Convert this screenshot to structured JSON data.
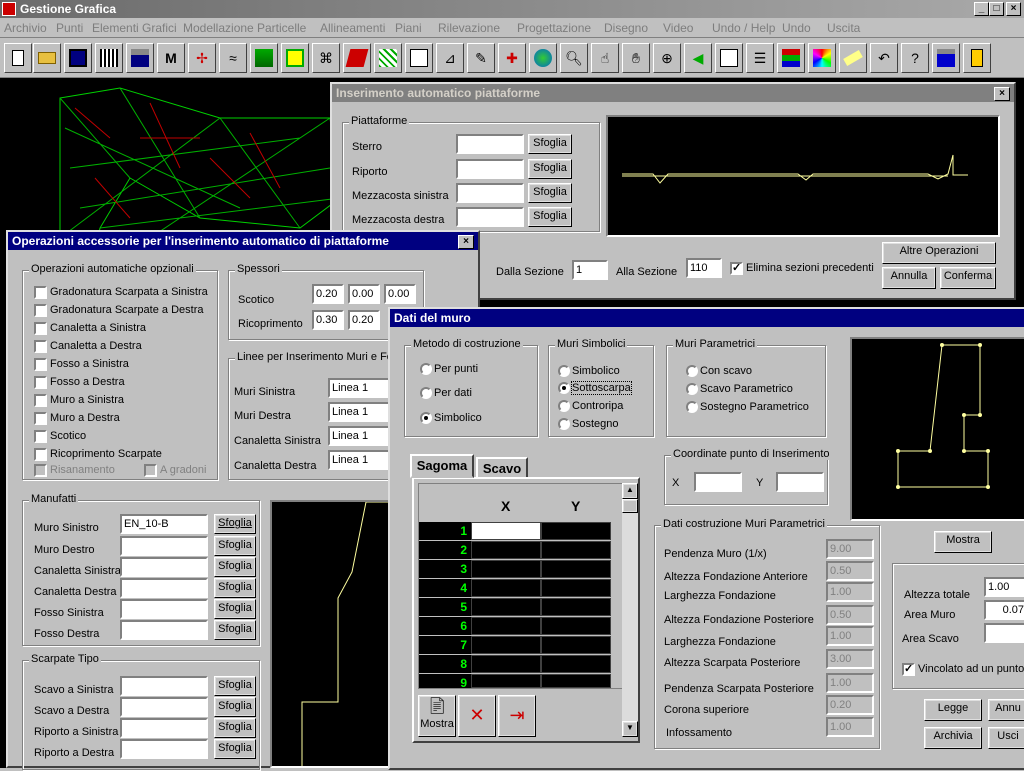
{
  "app": {
    "title": "Gestione Grafica",
    "min": "_",
    "max": "□",
    "close": "×"
  },
  "menu": [
    "Archivio",
    "Punti",
    "Elementi Grafici",
    "Modellazione",
    "Particelle",
    "Allineamenti",
    "Piani",
    "Rilevazione",
    "Progettazione",
    "Disegno",
    "Video",
    "Undo / Help",
    "Undo",
    "Uscita"
  ],
  "toolbar_m_label": "M",
  "piattaforme": {
    "title": "Inserimento automatico piattaforme",
    "group": "Piattaforme",
    "rows": [
      "Sterro",
      "Riporto",
      "Mezzacosta sinistra",
      "Mezzacosta destra"
    ],
    "browse": "Sfoglia",
    "dalla_label": "Dalla Sezione",
    "dalla_val": "1",
    "alla_label": "Alla Sezione",
    "alla_val": "110",
    "elimina": "Elimina sezioni precedenti",
    "altre": "Altre Operazioni",
    "annulla": "Annulla",
    "conferma": "Conferma"
  },
  "accessorie": {
    "title": "Operazioni accessorie per l'inserimento automatico di piattaforme",
    "auto_group": "Operazioni automatiche opzionali",
    "auto_items": [
      "Gradonatura Scarpata a Sinistra",
      "Gradonatura Scarpate a Destra",
      "Canaletta a Sinistra",
      "Canaletta a Destra",
      "Fosso a Sinistra",
      "Fosso a Destra",
      "Muro a Sinistra",
      "Muro a Destra",
      "Scotico",
      "Ricoprimento Scarpate"
    ],
    "risanamento": "Risanamento",
    "a_gradoni": "A gradoni",
    "spessori_group": "Spessori",
    "scotico_label": "Scotico",
    "scotico_vals": [
      "0.20",
      "0.00",
      "0.00"
    ],
    "ricopr_label": "Ricoprimento",
    "ricopr_vals": [
      "0.30",
      "0.20"
    ],
    "linee_group": "Linee per Inserimento Muri e Fos",
    "linee_rows": [
      {
        "label": "Muri Sinistra",
        "val": "Linea 1"
      },
      {
        "label": "Muri Destra",
        "val": "Linea 1"
      },
      {
        "label": "Canaletta Sinistra",
        "val": "Linea 1"
      },
      {
        "label": "Canaletta Destra",
        "val": "Linea 1"
      }
    ],
    "manufatti_group": "Manufatti",
    "manufatti_rows": [
      {
        "label": "Muro  Sinistro",
        "val": "EN_10-B"
      },
      {
        "label": "Muro Destro",
        "val": ""
      },
      {
        "label": "Canaletta Sinistra",
        "val": ""
      },
      {
        "label": "Canaletta Destra",
        "val": ""
      },
      {
        "label": "Fosso Sinistra",
        "val": ""
      },
      {
        "label": "Fosso Destra",
        "val": ""
      }
    ],
    "scarpate_group": "Scarpate Tipo",
    "scarpate_rows": [
      "Scavo a Sinistra",
      "Scavo a Destra",
      "Riporto a Sinistra",
      "Riporto a Destra"
    ],
    "browse": "Sfoglia"
  },
  "muro": {
    "title": "Dati del muro",
    "metodo_group": "Metodo di costruzione",
    "metodo_opts": [
      "Per punti",
      "Per dati",
      "Simbolico"
    ],
    "simb_group": "Muri Simbolici",
    "simb_opts": [
      "Simbolico",
      "Sottoscarpa",
      "Controripa",
      "Sostegno"
    ],
    "param_group": "Muri Parametrici",
    "param_opts": [
      "Con scavo",
      "Scavo Parametrico",
      "Sostegno Parametrico"
    ],
    "tabs": [
      "Sagoma",
      "Scavo"
    ],
    "grid_x": "X",
    "grid_y": "Y",
    "rows": [
      "1",
      "2",
      "3",
      "4",
      "5",
      "6",
      "7",
      "8",
      "9"
    ],
    "mostra_tool": "Mostra",
    "coord_group": "Coordinate punto di Inserimento",
    "coord_x": "X",
    "coord_y": "Y",
    "dati_group": "Dati costruzione Muri Parametrici",
    "dati_rows": [
      {
        "label": "Pendenza Muro (1/x)",
        "val": "9.00"
      },
      {
        "label": "Altezza Fondazione Anteriore",
        "val": "0.50"
      },
      {
        "label": "Larghezza Fondazione",
        "val": "1.00"
      },
      {
        "label": "Altezza Fondazione Posteriore",
        "val": "0.50"
      },
      {
        "label": "Larghezza Fondazione",
        "val": "1.00"
      },
      {
        "label": "Altezza Scarpata Posteriore",
        "val": "3.00"
      },
      {
        "label": "Pendenza Scarpata Posteriore",
        "val": "1.00"
      },
      {
        "label": "Corona superiore",
        "val": "0.20"
      },
      {
        "label": "Infossamento",
        "val": "1.00"
      }
    ],
    "mostra": "Mostra",
    "altezza_label": "Altezza totale",
    "altezza_val": "1.00",
    "area_muro_label": "Area Muro",
    "area_muro_val": "0.07",
    "area_scavo_label": "Area Scavo",
    "area_scavo_val": "",
    "vincolato": "Vincolato ad un punto",
    "legge": "Legge",
    "annu": "Annu",
    "archivia": "Archivia",
    "usci": "Usci"
  }
}
